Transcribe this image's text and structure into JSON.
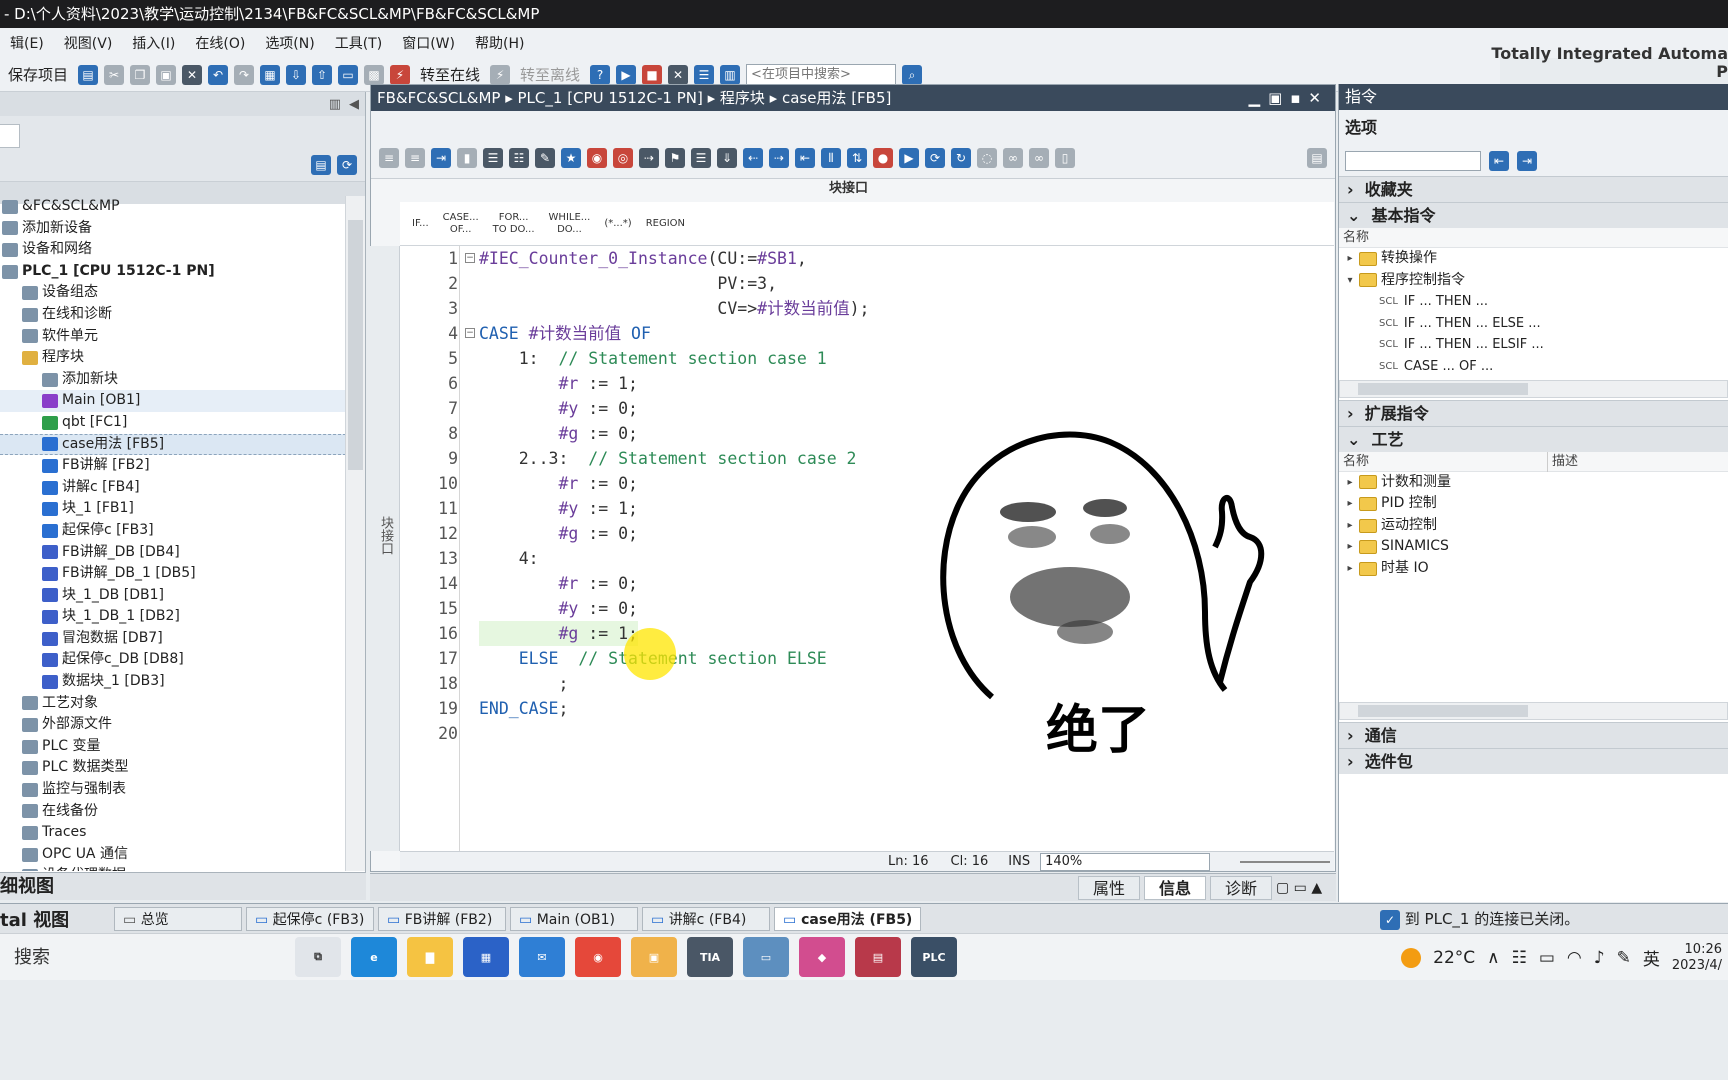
{
  "window": {
    "title": "- D:\\个人资料\\2023\\教学\\运动控制\\2134\\FB&FC&SCL&MP\\FB&FC&SCL&MP",
    "brand": "Totally Integrated Automa",
    "brand2": "P"
  },
  "menu": [
    "辑(E)",
    "视图(V)",
    "插入(I)",
    "在线(O)",
    "选项(N)",
    "工具(T)",
    "窗口(W)",
    "帮助(H)"
  ],
  "toolbar": {
    "save_label": "保存项目",
    "go_online": "转至在线",
    "go_offline": "转至离线",
    "search_placeholder": "<在项目中搜索>"
  },
  "project_tree": {
    "nodes": [
      {
        "label": "&FC&SCL&MP",
        "indent": 0,
        "icon": "project-icon"
      },
      {
        "label": "添加新设备",
        "indent": 0,
        "icon": "add-device-icon"
      },
      {
        "label": "设备和网络",
        "indent": 0,
        "icon": "network-icon"
      },
      {
        "label": "PLC_1 [CPU 1512C-1 PN]",
        "indent": 0,
        "icon": "plc-icon",
        "bold": true
      },
      {
        "label": "设备组态",
        "indent": 1,
        "icon": "device-config-icon"
      },
      {
        "label": "在线和诊断",
        "indent": 1,
        "icon": "diagnostics-icon"
      },
      {
        "label": "软件单元",
        "indent": 1,
        "icon": "software-unit-icon"
      },
      {
        "label": "程序块",
        "indent": 1,
        "icon": "folder-icon"
      },
      {
        "label": "添加新块",
        "indent": 2,
        "icon": "add-block-icon"
      },
      {
        "label": "Main [OB1]",
        "indent": 2,
        "icon": "ob-icon",
        "hl": true
      },
      {
        "label": "qbt [FC1]",
        "indent": 2,
        "icon": "fc-icon"
      },
      {
        "label": "case用法 [FB5]",
        "indent": 2,
        "icon": "fb-icon",
        "sel": true
      },
      {
        "label": "FB讲解 [FB2]",
        "indent": 2,
        "icon": "fb-icon"
      },
      {
        "label": "讲解c [FB4]",
        "indent": 2,
        "icon": "fb-icon"
      },
      {
        "label": "块_1 [FB1]",
        "indent": 2,
        "icon": "fb-icon"
      },
      {
        "label": "起保停c [FB3]",
        "indent": 2,
        "icon": "fb-icon"
      },
      {
        "label": "FB讲解_DB [DB4]",
        "indent": 2,
        "icon": "db-icon"
      },
      {
        "label": "FB讲解_DB_1 [DB5]",
        "indent": 2,
        "icon": "db-icon"
      },
      {
        "label": "块_1_DB [DB1]",
        "indent": 2,
        "icon": "db-icon"
      },
      {
        "label": "块_1_DB_1 [DB2]",
        "indent": 2,
        "icon": "db-icon"
      },
      {
        "label": "冒泡数据 [DB7]",
        "indent": 2,
        "icon": "db-icon"
      },
      {
        "label": "起保停c_DB [DB8]",
        "indent": 2,
        "icon": "db-icon"
      },
      {
        "label": "数据块_1 [DB3]",
        "indent": 2,
        "icon": "db-icon"
      },
      {
        "label": "工艺对象",
        "indent": 1,
        "icon": "tech-object-icon"
      },
      {
        "label": "外部源文件",
        "indent": 1,
        "icon": "external-source-icon"
      },
      {
        "label": "PLC 变量",
        "indent": 1,
        "icon": "plc-tags-icon"
      },
      {
        "label": "PLC 数据类型",
        "indent": 1,
        "icon": "plc-datatype-icon"
      },
      {
        "label": "监控与强制表",
        "indent": 1,
        "icon": "watch-table-icon"
      },
      {
        "label": "在线备份",
        "indent": 1,
        "icon": "online-backup-icon"
      },
      {
        "label": "Traces",
        "indent": 1,
        "icon": "traces-icon"
      },
      {
        "label": "OPC UA 通信",
        "indent": 1,
        "icon": "opcua-icon"
      },
      {
        "label": "设备代理数据",
        "indent": 1,
        "icon": "device-proxy-icon"
      }
    ],
    "footer": "细视图"
  },
  "editor": {
    "breadcrumb": "FB&FC&SCL&MP ▸ PLC_1 [CPU 1512C-1 PN] ▸ 程序块 ▸ case用法 [FB5]",
    "block_interface": "块接口",
    "side_label": "块接口",
    "snippets": [
      {
        "l1": "IF...",
        "l2": ""
      },
      {
        "l1": "CASE...",
        "l2": "OF..."
      },
      {
        "l1": "FOR...",
        "l2": "TO DO..."
      },
      {
        "l1": "WHILE...",
        "l2": "DO..."
      },
      {
        "l1": "(*...*)",
        "l2": ""
      },
      {
        "l1": "REGION",
        "l2": ""
      }
    ],
    "lines": [
      {
        "n": "1",
        "fold": "⊟",
        "segs": [
          [
            "var",
            "#IEC_Counter_0_Instance"
          ],
          [
            "plain",
            "(CU:="
          ],
          [
            "var",
            "#SB1"
          ],
          [
            "plain",
            ","
          ]
        ]
      },
      {
        "n": "2",
        "segs": [
          [
            "plain",
            "                        PV:=3,"
          ]
        ]
      },
      {
        "n": "3",
        "segs": [
          [
            "plain",
            "                        CV=>"
          ],
          [
            "var",
            "#计数当前值"
          ],
          [
            "plain",
            ");"
          ]
        ]
      },
      {
        "n": "4",
        "fold": "⊟",
        "segs": [
          [
            "kw",
            "CASE "
          ],
          [
            "var",
            "#计数当前值"
          ],
          [
            "kw",
            " OF"
          ]
        ]
      },
      {
        "n": "5",
        "segs": [
          [
            "plain",
            "    1:  "
          ],
          [
            "cmt",
            "// Statement section case 1"
          ]
        ]
      },
      {
        "n": "6",
        "segs": [
          [
            "plain",
            "        "
          ],
          [
            "var",
            "#r"
          ],
          [
            "plain",
            " := 1;"
          ]
        ]
      },
      {
        "n": "7",
        "segs": [
          [
            "plain",
            "        "
          ],
          [
            "var",
            "#y"
          ],
          [
            "plain",
            " := 0;"
          ]
        ]
      },
      {
        "n": "8",
        "segs": [
          [
            "plain",
            "        "
          ],
          [
            "var",
            "#g"
          ],
          [
            "plain",
            " := 0;"
          ]
        ]
      },
      {
        "n": "9",
        "segs": [
          [
            "plain",
            "    2..3:  "
          ],
          [
            "cmt",
            "// Statement section case 2"
          ]
        ]
      },
      {
        "n": "10",
        "segs": [
          [
            "plain",
            "        "
          ],
          [
            "var",
            "#r"
          ],
          [
            "plain",
            " := 0;"
          ]
        ]
      },
      {
        "n": "11",
        "segs": [
          [
            "plain",
            "        "
          ],
          [
            "var",
            "#y"
          ],
          [
            "plain",
            " := 1;"
          ]
        ]
      },
      {
        "n": "12",
        "segs": [
          [
            "plain",
            "        "
          ],
          [
            "var",
            "#g"
          ],
          [
            "plain",
            " := 0;"
          ]
        ]
      },
      {
        "n": "13",
        "segs": [
          [
            "plain",
            "    4:"
          ]
        ]
      },
      {
        "n": "14",
        "segs": [
          [
            "plain",
            "        "
          ],
          [
            "var",
            "#r"
          ],
          [
            "plain",
            " := 0;"
          ]
        ]
      },
      {
        "n": "15",
        "segs": [
          [
            "plain",
            "        "
          ],
          [
            "var",
            "#y"
          ],
          [
            "plain",
            " := 0;"
          ]
        ]
      },
      {
        "n": "16",
        "cur": true,
        "segs": [
          [
            "plain",
            "        "
          ],
          [
            "var",
            "#g"
          ],
          [
            "plain",
            " := 1;"
          ]
        ]
      },
      {
        "n": "17",
        "segs": [
          [
            "kw",
            "    ELSE"
          ],
          [
            "plain",
            "  "
          ],
          [
            "cmt",
            "// Statement section ELSE"
          ]
        ]
      },
      {
        "n": "18",
        "segs": [
          [
            "plain",
            "        ;"
          ]
        ]
      },
      {
        "n": "19",
        "segs": [
          [
            "kw",
            "END_CASE"
          ],
          [
            "plain",
            ";"
          ]
        ]
      },
      {
        "n": "20",
        "segs": [
          [
            "plain",
            ""
          ]
        ]
      }
    ],
    "status": {
      "ln": "Ln: 16",
      "cl": "Cl: 16",
      "mode": "INS",
      "zoom": "140%"
    },
    "info_tabs": [
      "属性",
      "信息",
      "诊断"
    ]
  },
  "meme": {
    "caption": "绝了"
  },
  "instructions_pane": {
    "title": "指令",
    "options": "选项",
    "sections": {
      "favorites": "收藏夹",
      "basic": "基本指令",
      "extended": "扩展指令",
      "tech": "工艺",
      "comm": "通信",
      "optional": "选件包"
    },
    "col_name": "名称",
    "col_desc": "描述",
    "basic_items": [
      {
        "label": "转换操作",
        "ex": "▸",
        "folder": true
      },
      {
        "label": "程序控制指令",
        "ex": "▾",
        "folder": true
      },
      {
        "label": "IF ... THEN ...",
        "scl": true
      },
      {
        "label": "IF ... THEN ... ELSE ...",
        "scl": true
      },
      {
        "label": "IF ... THEN ... ELSIF ...",
        "scl": true
      },
      {
        "label": "CASE ... OF ...",
        "scl": true
      }
    ],
    "tech_items": [
      "计数和测量",
      "PID 控制",
      "运动控制",
      "SINAMICS",
      "时基 IO"
    ]
  },
  "bottom_tabs": {
    "portal_view": "tal 视图",
    "tabs": [
      "总览",
      "起保停c (FB3)",
      "FB讲解 (FB2)",
      "Main (OB1)",
      "讲解c (FB4)",
      "case用法 (FB5)"
    ],
    "active": 5,
    "connection_msg": "到 PLC_1 的连接已关闭。"
  },
  "taskbar": {
    "search": "搜索",
    "weather": "22°C",
    "ime": "英",
    "time": "10:26",
    "date": "2023/4/"
  }
}
